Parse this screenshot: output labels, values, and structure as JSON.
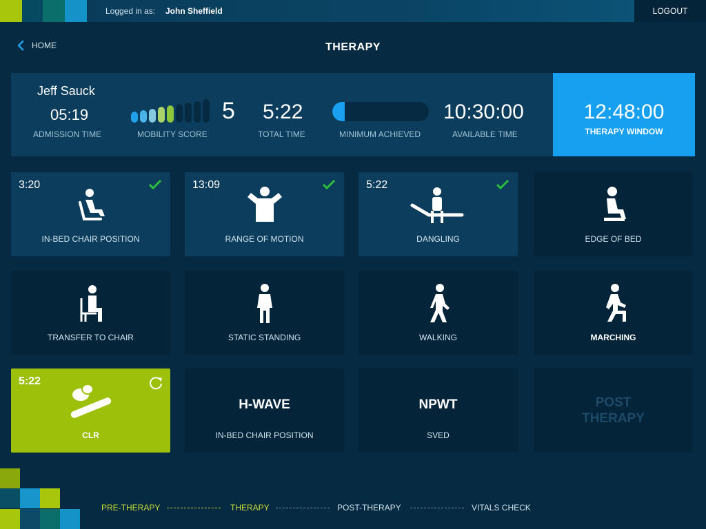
{
  "topbar": {
    "logged_in_label": "Logged in as:",
    "user_name": "John Sheffield",
    "logout_label": "LOGOUT"
  },
  "header": {
    "home_label": "HOME",
    "title": "THERAPY"
  },
  "stats": {
    "patient_name": "Jeff Sauck",
    "admission_time": "05:19",
    "admission_label": "ADMISSION TIME",
    "mobility_score": "5",
    "mobility_label": "MOBILITY SCORE",
    "mobility_level": 5,
    "mobility_max": 9,
    "total_time": "5:22",
    "total_label": "TOTAL TIME",
    "minimum_label": "MINIMUM ACHIEVED",
    "minimum_progress": 0.13,
    "available_time": "10:30:00",
    "available_label": "AVAILABLE TIME",
    "therapy_window_time": "12:48:00",
    "therapy_window_label": "THERAPY WINDOW"
  },
  "tiles": [
    {
      "time": "3:20",
      "label": "IN-BED CHAIR POSITION",
      "icon": "in-bed-chair-icon",
      "done": true
    },
    {
      "time": "13:09",
      "label": "RANGE OF MOTION",
      "icon": "range-of-motion-icon",
      "done": true
    },
    {
      "time": "5:22",
      "label": "DANGLING",
      "icon": "dangling-icon",
      "done": true
    },
    {
      "time": "",
      "label": "EDGE OF BED",
      "icon": "edge-of-bed-icon",
      "done": false
    },
    {
      "time": "",
      "label": "TRANSFER TO CHAIR",
      "icon": "transfer-to-chair-icon",
      "done": false
    },
    {
      "time": "",
      "label": "STATIC STANDING",
      "icon": "standing-icon",
      "done": false
    },
    {
      "time": "",
      "label": "WALKING",
      "icon": "walking-icon",
      "done": false
    },
    {
      "time": "",
      "label": "MARCHING",
      "icon": "marching-icon",
      "done": false
    },
    {
      "time": "5:22",
      "label": "CLR",
      "icon": "clr-icon",
      "active": true
    },
    {
      "heading": "H-WAVE",
      "label": "IN-BED CHAIR POSITION"
    },
    {
      "heading": "NPWT",
      "label": "SVED"
    },
    {
      "heading": "POST THERAPY",
      "heading_line1": "POST",
      "heading_line2": "THERAPY"
    }
  ],
  "steps": [
    {
      "label": "PRE-THERAPY",
      "status": "done"
    },
    {
      "label": "THERAPY",
      "status": "current"
    },
    {
      "label": "POST-THERAPY",
      "status": "pending"
    },
    {
      "label": "VITALS CHECK",
      "status": "pending"
    }
  ],
  "colors": {
    "background": "#062a41",
    "panel": "#0c3d5c",
    "accent_blue": "#17a0ef",
    "accent_green": "#9dc00a",
    "check_green": "#2bbf3a"
  }
}
